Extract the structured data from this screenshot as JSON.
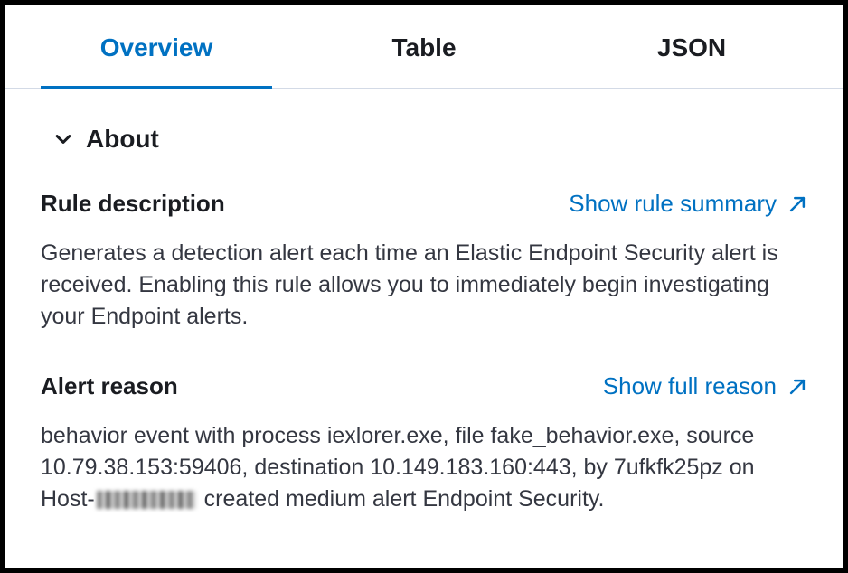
{
  "tabs": {
    "overview": "Overview",
    "table": "Table",
    "json": "JSON"
  },
  "about": {
    "title": "About"
  },
  "rule": {
    "label": "Rule description",
    "link": "Show rule summary",
    "text": "Generates a detection alert each time an Elastic Endpoint Security alert is received. Enabling this rule allows you to immediately begin investigating your Endpoint alerts."
  },
  "reason": {
    "label": "Alert reason",
    "link": "Show full reason",
    "text_prefix": "behavior event with process iexlorer.exe, file fake_behavior.exe, source 10.79.38.153:59406, destination 10.149.183.160:443, by 7ufkfk25pz on Host-",
    "text_suffix": " created medium alert Endpoint Security."
  }
}
